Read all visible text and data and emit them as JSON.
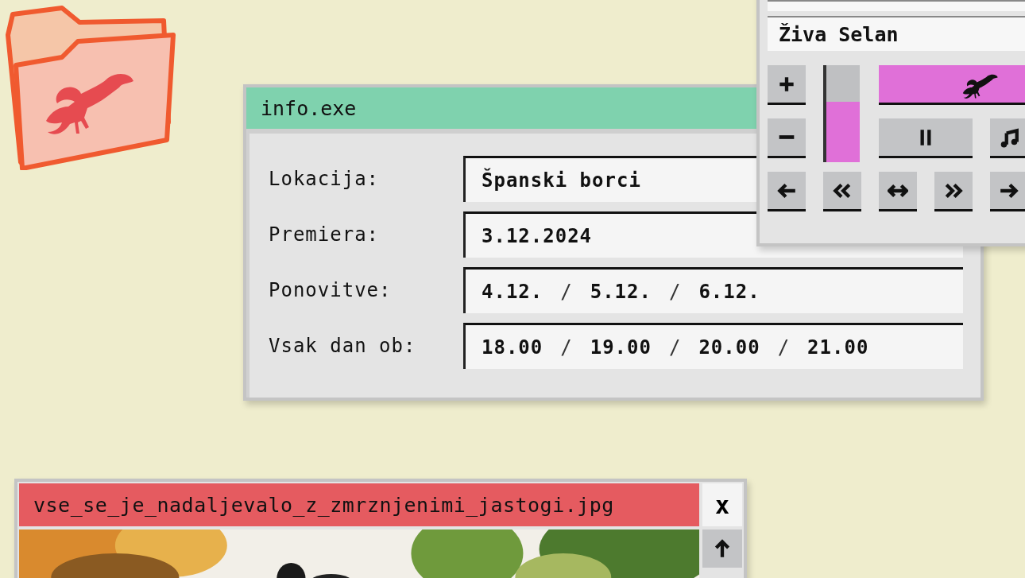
{
  "info_window": {
    "title": "info.exe",
    "rows": [
      {
        "label": "Lokacija:",
        "values": [
          "Španski borci"
        ]
      },
      {
        "label": "Premiera:",
        "values": [
          "3.12.2024"
        ]
      },
      {
        "label": "Ponovitve:",
        "values": [
          "4.12.",
          "5.12.",
          "6.12."
        ],
        "separator": "/"
      },
      {
        "label": "Vsak dan ob:",
        "values": [
          "18.00",
          "19.00",
          "20.00",
          "21.00"
        ],
        "separator": "/"
      }
    ]
  },
  "player_window": {
    "field": "Živa Selan",
    "volume": {
      "level": 0.62
    }
  },
  "image_window": {
    "title": "vse_se_je_nadaljevalo_z_zmrznjenimi_jastogi.jpg",
    "close": "x"
  }
}
